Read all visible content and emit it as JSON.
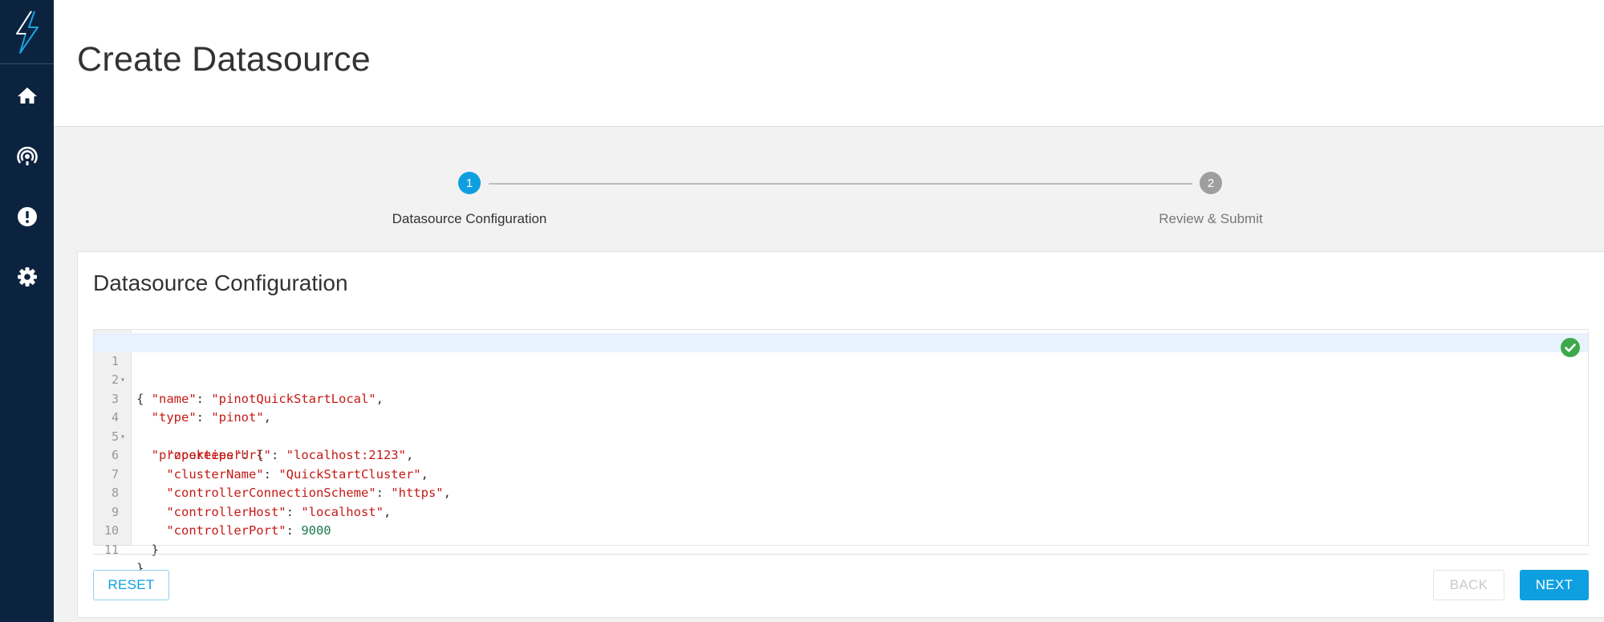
{
  "sidebar": {
    "logo_icon": "lightning-bolt-icon",
    "items": [
      {
        "name": "home",
        "icon": "home-icon"
      },
      {
        "name": "broadcast",
        "icon": "broadcast-icon"
      },
      {
        "name": "alerts",
        "icon": "alert-circle-icon"
      },
      {
        "name": "settings",
        "icon": "gear-icon"
      }
    ]
  },
  "header": {
    "title": "Create Datasource"
  },
  "stepper": {
    "steps": [
      {
        "number": "1",
        "label": "Datasource Configuration",
        "state": "active"
      },
      {
        "number": "2",
        "label": "Review & Submit",
        "state": "inactive"
      }
    ]
  },
  "card": {
    "title": "Datasource Configuration",
    "editor": {
      "line_numbers": [
        "1",
        "2",
        "3",
        "4",
        "5",
        "6",
        "7",
        "8",
        "9",
        "10",
        "11"
      ],
      "valid": true,
      "valid_icon": "check-circle-icon"
    }
  },
  "buttons": {
    "reset": "RESET",
    "back": "BACK",
    "next": "NEXT"
  },
  "json_code": {
    "name_key": "\"name\"",
    "name_val": "\"pinotQuickStartLocal\"",
    "type_key": "\"type\"",
    "type_val": "\"pinot\"",
    "props_key": "\"properties\"",
    "zk_key": "\"zookeeperUrl\"",
    "zk_val": "\"localhost:2123\"",
    "cluster_key": "\"clusterName\"",
    "cluster_val": "\"QuickStartCluster\"",
    "scheme_key": "\"controllerConnectionScheme\"",
    "scheme_val": "\"https\"",
    "host_key": "\"controllerHost\"",
    "host_val": "\"localhost\"",
    "port_key": "\"controllerPort\"",
    "port_val": "9000"
  },
  "colors": {
    "sidebar_bg": "#0c2340",
    "accent": "#0e9fe1",
    "success": "#3da94b",
    "json_string": "#c41a16",
    "json_number": "#1c7a4f"
  }
}
